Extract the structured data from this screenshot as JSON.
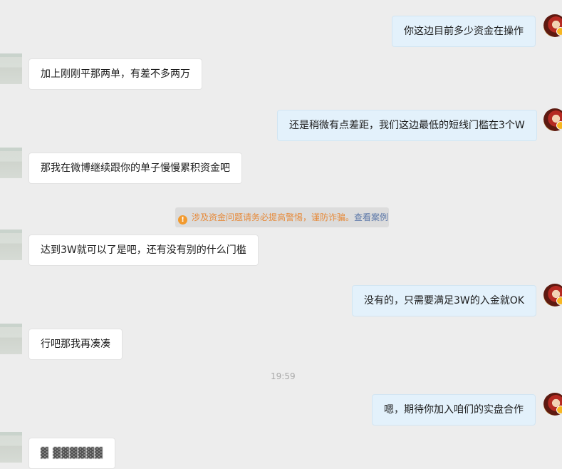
{
  "messages": [
    {
      "side": "out",
      "text": "你这边目前多少资金在操作"
    },
    {
      "side": "in",
      "text": "加上刚刚平那两单，有差不多两万"
    },
    {
      "side": "out",
      "text": "还是稍微有点差距，我们这边最低的短线门槛在3个W"
    },
    {
      "side": "in",
      "text": "那我在微博继续跟你的单子慢慢累积资金吧"
    },
    {
      "side": "in",
      "text": "达到3W就可以了是吧，还有没有别的什么门槛"
    },
    {
      "side": "out",
      "text": "没有的，只需要满足3W的入金就OK"
    },
    {
      "side": "in",
      "text": "行吧那我再凑凑"
    },
    {
      "side": "out",
      "text": "嗯，期待你加入咱们的实盘合作"
    },
    {
      "side": "in",
      "text": "▓ ▓▓▓▓▓▓"
    }
  ],
  "notice": {
    "text": "涉及资金问题请务必提高警惕，谨防诈骗。",
    "link": "查看案例"
  },
  "timestamp": "19:59",
  "colors": {
    "background": "#ededed",
    "incoming_bubble": "#ffffff",
    "outgoing_bubble": "#e3f1fb",
    "notice_text": "#e68a3a",
    "notice_link": "#5b77a8"
  }
}
